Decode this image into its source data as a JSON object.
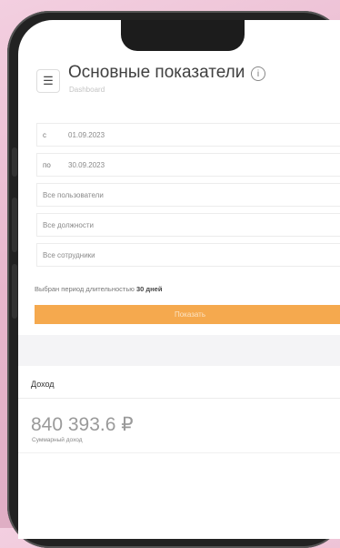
{
  "header": {
    "title": "Основные показатели",
    "subtitle": "Dashboard"
  },
  "filters": {
    "date_from_prefix": "с",
    "date_from": "01.09.2023",
    "date_to_prefix": "по",
    "date_to": "30.09.2023",
    "users": "Все пользователи",
    "positions": "Все должности",
    "employees": "Все сотрудники"
  },
  "period_note": {
    "text": "Выбран период длительностью",
    "value": "30 дней"
  },
  "show_button": "Показать",
  "income": {
    "label": "Доход",
    "value": "840 393.6 ₽",
    "caption": "Суммарный доход"
  }
}
